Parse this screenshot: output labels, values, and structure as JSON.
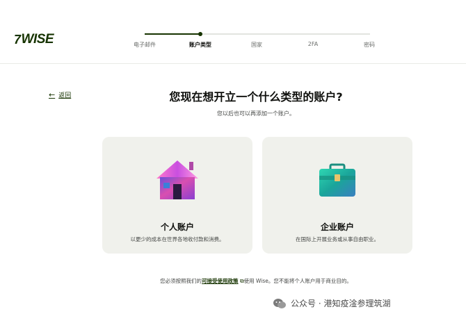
{
  "brand": {
    "logo_text": "WISE",
    "logo_mark": "7"
  },
  "stepper": {
    "steps": [
      "电子邮件",
      "账户类型",
      "国家",
      "2FA",
      "密码"
    ],
    "active_index": 1
  },
  "back": {
    "label": "返回"
  },
  "page": {
    "title": "您现在想开立一个什么类型的账户?",
    "subtitle": "您以后也可以再添加一个账户。"
  },
  "cards": {
    "personal": {
      "title": "个人账户",
      "desc": "以更少的成本在世界各地收付款和消费。",
      "icon": "house-icon"
    },
    "business": {
      "title": "企业账户",
      "desc": "在国际上开展业务或从事自由职业。",
      "icon": "briefcase-icon"
    }
  },
  "policy": {
    "prefix": "您必须按照我们的",
    "link": "可接受使用政策",
    "suffix": "使用 Wise。您不能将个人账户用于商业目的。"
  },
  "watermark": {
    "text": "公众号 · 港知疫淦参理筑湖"
  },
  "colors": {
    "brand_dark": "#163300",
    "card_bg": "#f0f1ec"
  }
}
